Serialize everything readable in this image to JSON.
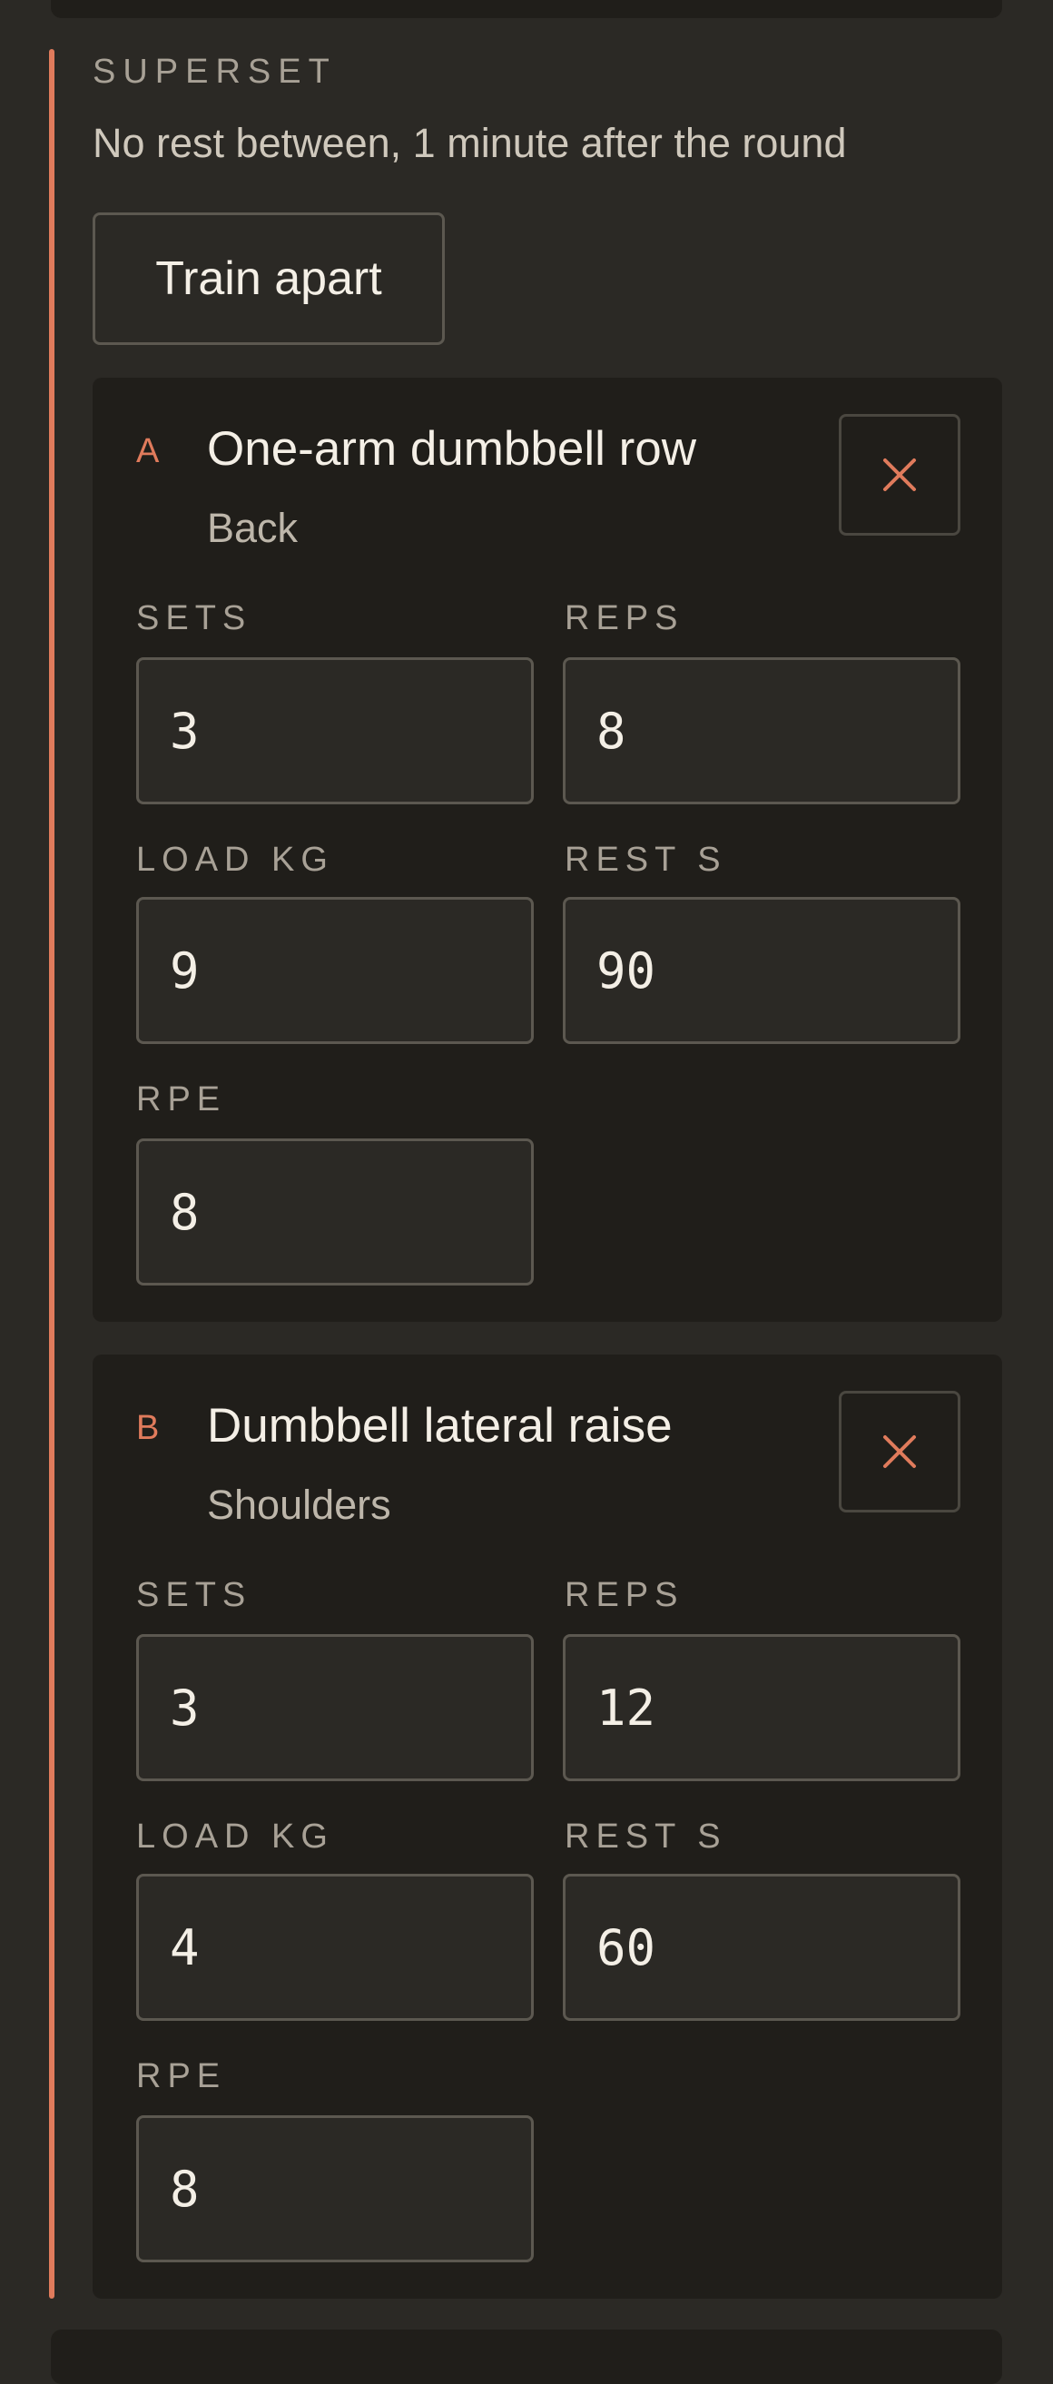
{
  "superset": {
    "label": "SUPERSET",
    "description": "No rest between, 1 minute after the round",
    "train_apart_label": "Train apart"
  },
  "exercises": [
    {
      "letter": "A",
      "name": "One-arm dumbbell row",
      "muscle_group": "Back",
      "fields": {
        "sets": {
          "label": "SETS",
          "value": "3"
        },
        "reps": {
          "label": "REPS",
          "value": "8"
        },
        "load": {
          "label": "LOAD KG",
          "value": "9"
        },
        "rest": {
          "label": "REST S",
          "value": "90"
        },
        "rpe": {
          "label": "RPE",
          "value": "8"
        }
      }
    },
    {
      "letter": "B",
      "name": "Dumbbell lateral raise",
      "muscle_group": "Shoulders",
      "fields": {
        "sets": {
          "label": "SETS",
          "value": "3"
        },
        "reps": {
          "label": "REPS",
          "value": "12"
        },
        "load": {
          "label": "LOAD KG",
          "value": "4"
        },
        "rest": {
          "label": "REST S",
          "value": "60"
        },
        "rpe": {
          "label": "RPE",
          "value": "8"
        }
      }
    }
  ],
  "icons": {
    "remove": "close-icon"
  },
  "colors": {
    "accent": "#e07b5c",
    "background": "#2b2925",
    "card": "#201e1a"
  }
}
